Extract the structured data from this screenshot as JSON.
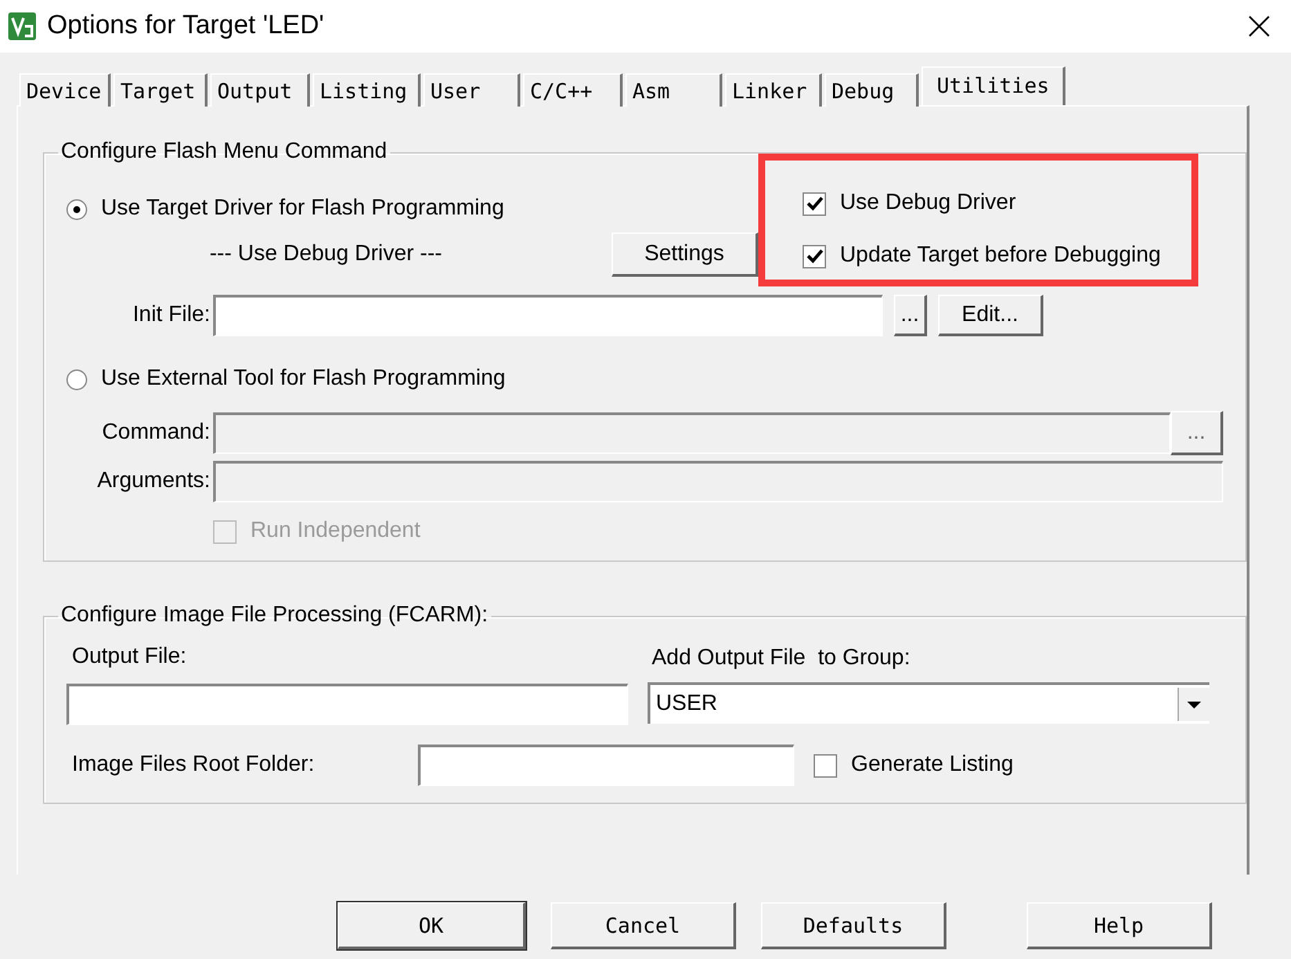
{
  "window": {
    "title": "Options for Target 'LED'"
  },
  "tabs": [
    {
      "label": "Device",
      "selected": false
    },
    {
      "label": "Target",
      "selected": false
    },
    {
      "label": "Output",
      "selected": false
    },
    {
      "label": "Listing",
      "selected": false
    },
    {
      "label": "User",
      "selected": false
    },
    {
      "label": "C/C++",
      "selected": false
    },
    {
      "label": "Asm",
      "selected": false
    },
    {
      "label": "Linker",
      "selected": false
    },
    {
      "label": "Debug",
      "selected": false
    },
    {
      "label": "Utilities",
      "selected": true
    }
  ],
  "flash_group": {
    "title": "Configure Flash Menu Command",
    "options": [
      {
        "label": "Use Target Driver for Flash Programming",
        "selected": true
      },
      {
        "label": "Use External Tool for Flash Programming",
        "selected": false
      }
    ],
    "driver_note": "--- Use Debug Driver ---",
    "settings_button": "Settings",
    "checkboxes": [
      {
        "label": "Use Debug Driver",
        "checked": true
      },
      {
        "label": "Update Target before Debugging",
        "checked": true
      }
    ],
    "init_file": {
      "label": "Init File:",
      "browse_button": "...",
      "edit_button": "Edit..."
    },
    "command": {
      "label": "Command:",
      "browse_button": "...",
      "disabled": true
    },
    "arguments": {
      "label": "Arguments:",
      "disabled": true
    },
    "run_independent": {
      "label": "Run Independent",
      "checked": false,
      "disabled": true
    }
  },
  "image_group": {
    "title": "Configure Image File Processing (FCARM):",
    "output_file": {
      "label": "Output File:"
    },
    "group_select": {
      "label": "Add Output File  to Group:",
      "value": "USER"
    },
    "root_folder": {
      "label": "Image Files Root Folder:"
    },
    "generate_listing": {
      "label": "Generate Listing",
      "checked": false
    }
  },
  "buttons": [
    "OK",
    "Cancel",
    "Defaults",
    "Help"
  ]
}
